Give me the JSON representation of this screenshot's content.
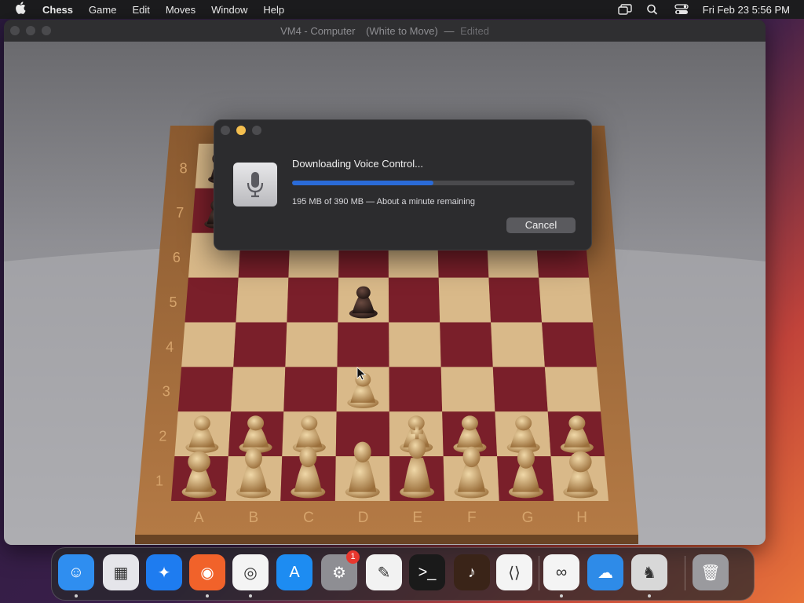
{
  "menubar": {
    "app_name": "Chess",
    "items": [
      "Game",
      "Edit",
      "Moves",
      "Window",
      "Help"
    ],
    "clock": "Fri Feb 23  5:56 PM"
  },
  "window": {
    "title_main": "VM4 - Computer",
    "title_state": "(White to Move)",
    "title_sep": "—",
    "title_edited": "Edited"
  },
  "board": {
    "ranks": [
      "8",
      "7",
      "6",
      "5",
      "4",
      "3",
      "2",
      "1"
    ],
    "files": [
      "A",
      "B",
      "C",
      "D",
      "E",
      "F",
      "G",
      "H"
    ],
    "colors": {
      "dark": "#7a1f2a",
      "light": "#d9b989",
      "frame": "#a0683a"
    }
  },
  "dialog": {
    "title": "Downloading Voice Control...",
    "status": "195 MB of 390 MB — About a minute remaining",
    "progress_fraction": 0.5,
    "cancel_label": "Cancel",
    "icon": "microphone-icon"
  },
  "dock": {
    "items": [
      {
        "name": "finder",
        "icon": "finder-icon",
        "color": "#2f8ef0",
        "glyph": "☺",
        "running": true
      },
      {
        "name": "launchpad",
        "icon": "launchpad-icon",
        "color": "#e5e5ea",
        "glyph": "▦",
        "running": false
      },
      {
        "name": "safari",
        "icon": "safari-icon",
        "color": "#1e7cf0",
        "glyph": "✦",
        "running": false
      },
      {
        "name": "firefox",
        "icon": "firefox-icon",
        "color": "#f1622a",
        "glyph": "◉",
        "running": true
      },
      {
        "name": "chrome",
        "icon": "chrome-icon",
        "color": "#f4f4f4",
        "glyph": "◎",
        "running": true
      },
      {
        "name": "app-store",
        "icon": "app-store-icon",
        "color": "#1d8cf2",
        "glyph": "A",
        "running": false
      },
      {
        "name": "system-settings",
        "icon": "gear-icon",
        "color": "#8e8e93",
        "glyph": "⚙",
        "running": false,
        "badge": "1"
      },
      {
        "name": "textedit",
        "icon": "textedit-icon",
        "color": "#f2f2f2",
        "glyph": "✎",
        "running": false
      },
      {
        "name": "terminal",
        "icon": "terminal-icon",
        "color": "#1a1a1a",
        "glyph": ">_",
        "running": false
      },
      {
        "name": "garageband",
        "icon": "guitar-icon",
        "color": "#3a2418",
        "glyph": "♪",
        "running": false
      },
      {
        "name": "vscode",
        "icon": "vscode-icon",
        "color": "#f4f4f4",
        "glyph": "⟨⟩",
        "running": false
      },
      {
        "name": "visual-studio",
        "icon": "visual-studio-icon",
        "color": "#f4f4f4",
        "glyph": "∞",
        "running": true
      },
      {
        "name": "weather",
        "icon": "weather-icon",
        "color": "#2e8be8",
        "glyph": "☁",
        "running": false
      },
      {
        "name": "chess",
        "icon": "chess-icon",
        "color": "#d8d8d8",
        "glyph": "♞",
        "running": true
      },
      {
        "name": "trash",
        "icon": "trash-icon",
        "color": "#9a9a9e",
        "glyph": "🗑",
        "running": false
      }
    ]
  }
}
